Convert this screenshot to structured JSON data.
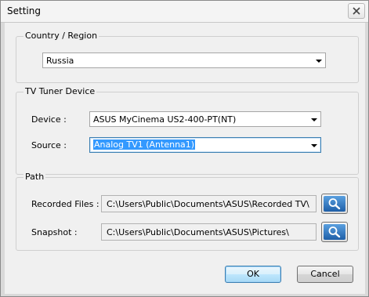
{
  "window": {
    "title": "Setting"
  },
  "country_region": {
    "group_title": "Country / Region",
    "selected": "Russia"
  },
  "tuner": {
    "group_title": "TV Tuner Device",
    "device_label": "Device :",
    "device_value": "ASUS MyCinema US2-400-PT(NT)",
    "source_label": "Source :",
    "source_value": "Analog TV1 (Antenna1)"
  },
  "path": {
    "group_title": "Path",
    "recorded_label": "Recorded Files :",
    "recorded_value": "C:\\Users\\Public\\Documents\\ASUS\\Recorded TV\\",
    "snapshot_label": "Snapshot :",
    "snapshot_value": "C:\\Users\\Public\\Documents\\ASUS\\Pictures\\"
  },
  "buttons": {
    "ok": "OK",
    "cancel": "Cancel"
  },
  "icons": {
    "close": "close-icon",
    "browse": "magnifier-icon"
  }
}
